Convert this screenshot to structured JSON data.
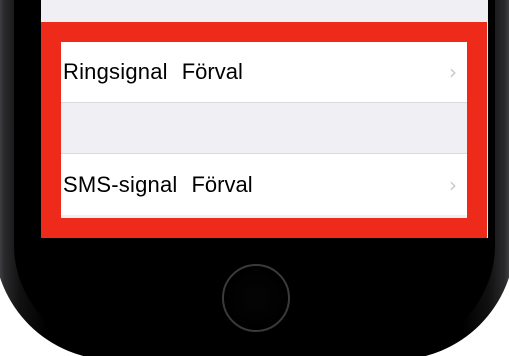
{
  "settings": {
    "rows": [
      {
        "label": "Ringsignal",
        "value": "Förval"
      },
      {
        "label": "SMS-signal",
        "value": "Förval"
      }
    ],
    "chevron": "›"
  },
  "colors": {
    "highlight": "#ee2a1a",
    "background": "#efeff4",
    "chevron": "#c7c7cc"
  },
  "icons": {
    "chevron": "chevron-right-icon",
    "home_button": "home-button"
  }
}
